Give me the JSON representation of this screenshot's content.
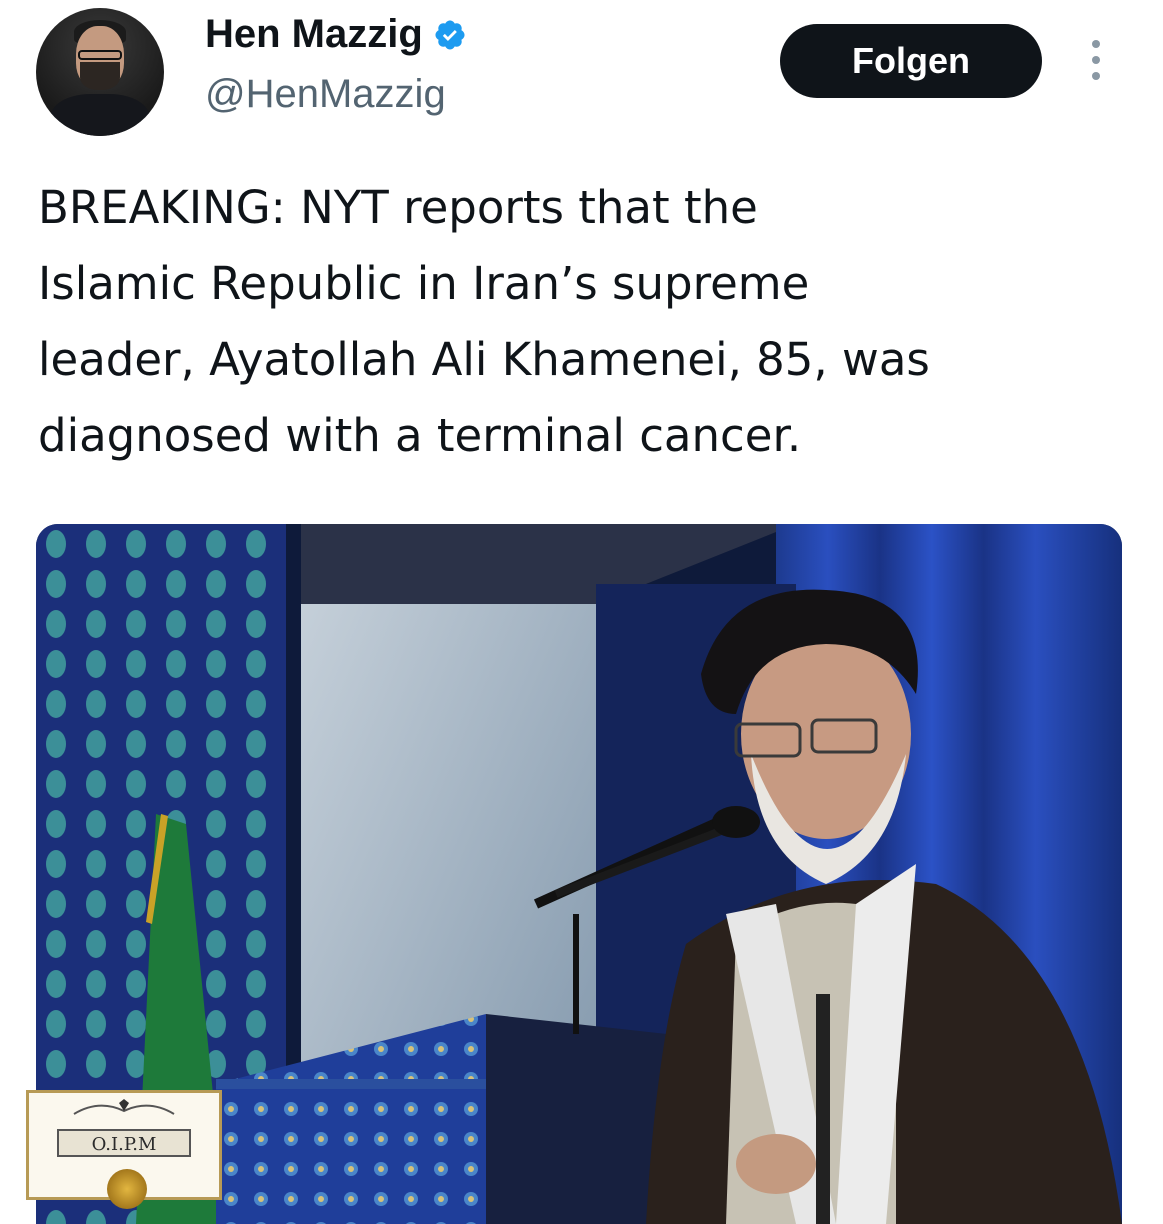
{
  "tweet": {
    "author": {
      "display_name": "Hen Mazzig",
      "handle": "@HenMazzig",
      "verified": true,
      "verified_icon": "verified-badge-icon",
      "verified_color": "#1d9bf0"
    },
    "follow_button_label": "Folgen",
    "more_icon": "more-dots-icon",
    "text_lines": [
      "BREAKING: NYT reports that the",
      "Islamic Republic in Iran’s supreme",
      "leader, Ayatollah Ali Khamenei, 85, was",
      "diagnosed with a terminal cancer."
    ],
    "media": {
      "kind": "photo",
      "watermark_text": "O.I.P.M"
    }
  }
}
